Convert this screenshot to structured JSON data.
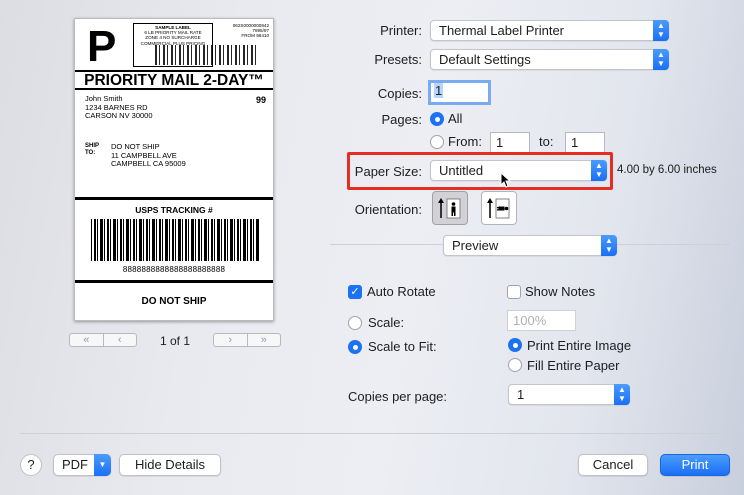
{
  "preview": {
    "big_letter": "P",
    "stamp_line1": "SAMPLE LABEL",
    "stamp_line2": "6 LB PRIORITY MAIL RATE",
    "stamp_line3": "ZONE 4 NO SURCHARGE",
    "stamp_line4": "COMMERCIAL PLUS PRICING",
    "stamp_num1": "062S0000000842",
    "stamp_num2": "7895/97",
    "stamp_num3": "FROM 96410",
    "service_title": "PRIORITY MAIL 2-DAY™",
    "from_name": "John Smith",
    "from_street": "1234 BARNES RD",
    "from_city": "CARSON NV 30000",
    "from_code": "99",
    "ship_to_label_1": "SHIP",
    "ship_to_label_2": "TO:",
    "to_name": "DO NOT SHIP",
    "to_street": "11 CAMPBELL AVE",
    "to_city": "CAMPBELL CA 95009",
    "tracking_title": "USPS TRACKING #",
    "tracking_number": "8888888888888888888888",
    "footer_text": "DO NOT SHIP",
    "page_indicator": "1 of 1",
    "nav_first": "«",
    "nav_prev": "‹",
    "nav_next": "›",
    "nav_last": "»"
  },
  "form": {
    "printer_label": "Printer:",
    "printer_value": "Thermal Label Printer",
    "presets_label": "Presets:",
    "presets_value": "Default Settings",
    "copies_label": "Copies:",
    "copies_value": "1",
    "pages_label": "Pages:",
    "pages_all": "All",
    "pages_from": "From:",
    "pages_from_value": "1",
    "pages_to": "to:",
    "pages_to_value": "1",
    "paper_size_label": "Paper Size:",
    "paper_size_value": "Untitled",
    "paper_size_dims": "4.00 by 6.00 inches",
    "orientation_label": "Orientation:",
    "section_value": "Preview"
  },
  "preview_options": {
    "auto_rotate": "Auto Rotate",
    "show_notes": "Show Notes",
    "scale": "Scale:",
    "scale_value": "100%",
    "scale_to_fit": "Scale to Fit:",
    "print_entire_image": "Print Entire Image",
    "fill_entire_paper": "Fill Entire Paper",
    "copies_per_page_label": "Copies per page:",
    "copies_per_page_value": "1"
  },
  "footer": {
    "help": "?",
    "pdf": "PDF",
    "hide_details": "Hide Details",
    "cancel": "Cancel",
    "print": "Print"
  },
  "colors": {
    "accent": "#1b72f5",
    "highlight_box": "#e52d23"
  }
}
